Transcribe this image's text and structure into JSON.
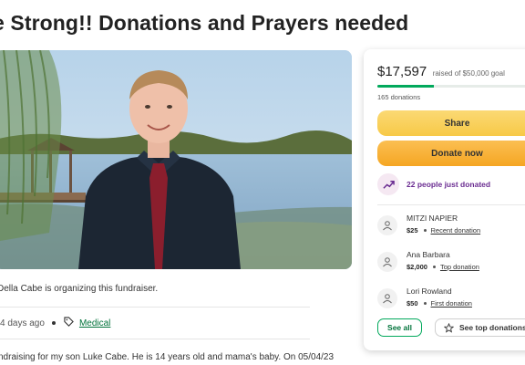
{
  "campaign": {
    "title": "e Strong!! Donations and Prayers needed",
    "organizer_text": "Della Cabe is organizing this fundraiser.",
    "created": "4 days ago",
    "category": "Medical",
    "story_excerpt": "ndraising for my son Luke Cabe. He is 14 years old and mama's baby. On 05/04/23"
  },
  "donation_card": {
    "raised_amount": "$17,597",
    "goal_text": "raised of $50,000 goal",
    "progress_fraction": 0.352,
    "donation_count": "165 donations",
    "share_label": "Share",
    "donate_label": "Donate now",
    "trend_text": "22 people just donated",
    "donors": [
      {
        "name": "MITZI NAPIER",
        "amount": "$25",
        "kind": "Recent donation"
      },
      {
        "name": "Ana Barbara",
        "amount": "$2,000",
        "kind": "Top donation"
      },
      {
        "name": "Lori Rowland",
        "amount": "$50",
        "kind": "First donation"
      }
    ],
    "see_all_label": "See all",
    "see_top_label": "See top donations"
  },
  "colors": {
    "brand_green": "#02a95c",
    "share_yellow": "#f7c947",
    "donate_orange": "#f5a623",
    "trend_purple": "#6a2c91"
  }
}
